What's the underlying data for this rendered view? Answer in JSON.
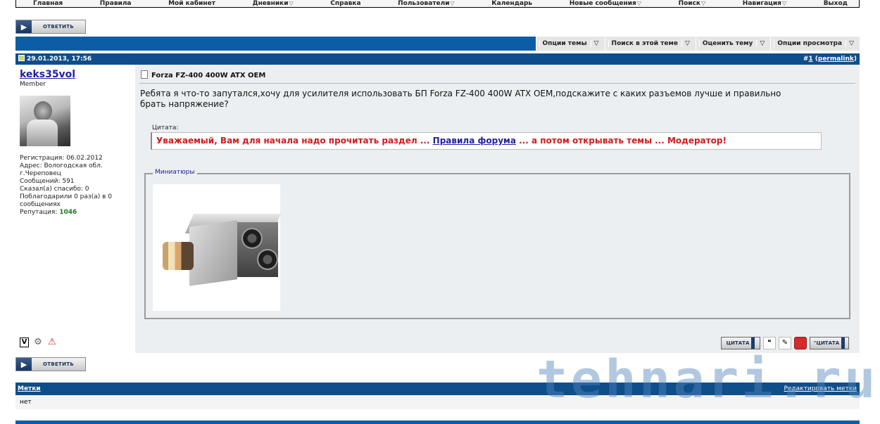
{
  "nav": {
    "items": [
      "Главная",
      "Правила",
      "Мой кабинет",
      "Дневники",
      "Справка",
      "Пользователи",
      "Календарь",
      "Новые сообщения",
      "Поиск",
      "Навигация",
      "Выход"
    ],
    "dropdown_items": [
      3,
      5,
      7,
      8,
      9
    ]
  },
  "reply_button": {
    "label": "ОТВЕТИТЬ"
  },
  "thread_tools": [
    "Опции темы",
    "Поиск в этой теме",
    "Оценить тему",
    "Опции просмотра"
  ],
  "post": {
    "date": "29.01.2013, 17:56",
    "number_prefix": "#",
    "number": "1",
    "permalink_open": " (",
    "permalink": "permalink",
    "permalink_close": ")",
    "title": "Forza FZ-400 400W ATX OEM",
    "body": "Ребята я что-то запутался,хочу для усилителя использовать БП Forza FZ-400 400W ATX OEM,подскажите с каких разъемов лучше и правильно брать напряжение?",
    "quote_label": "Цитата:",
    "quote_text_1": "Уважаемый, Вам для начала надо прочитать раздел ... ",
    "quote_link": "Правила форума",
    "quote_text_2": " ... а потом открывать темы ... Модератор!",
    "thumbnails_label": "Миниатюры"
  },
  "user": {
    "name": "keks35vol",
    "title": "Member",
    "registration": "Регистрация: 06.02.2012",
    "address": "Адрес: Вологодская обл. г.Череповец",
    "posts": "Сообщений: 591",
    "thanks_said": "Сказал(а) спасибо: 0",
    "thanked": "Поблагодарили 0 раз(а) в 0 сообщениях",
    "reputation_label": "Репутация: ",
    "reputation": "1046"
  },
  "actions": {
    "quote": "ЦИТАТА",
    "multiquote": "\"ЦИТАТА"
  },
  "tags": {
    "title": "Метки",
    "edit": "Редактировать метки",
    "value": "нет"
  },
  "watermark": "tehnari.ru",
  "colors": {
    "primary_bar": "#0d5da6",
    "post_header": "#0e4e8a",
    "post_bg": "#eceff1",
    "quote_red": "#d21b1b",
    "link": "#22229c",
    "reputation": "#1e7a1e"
  }
}
